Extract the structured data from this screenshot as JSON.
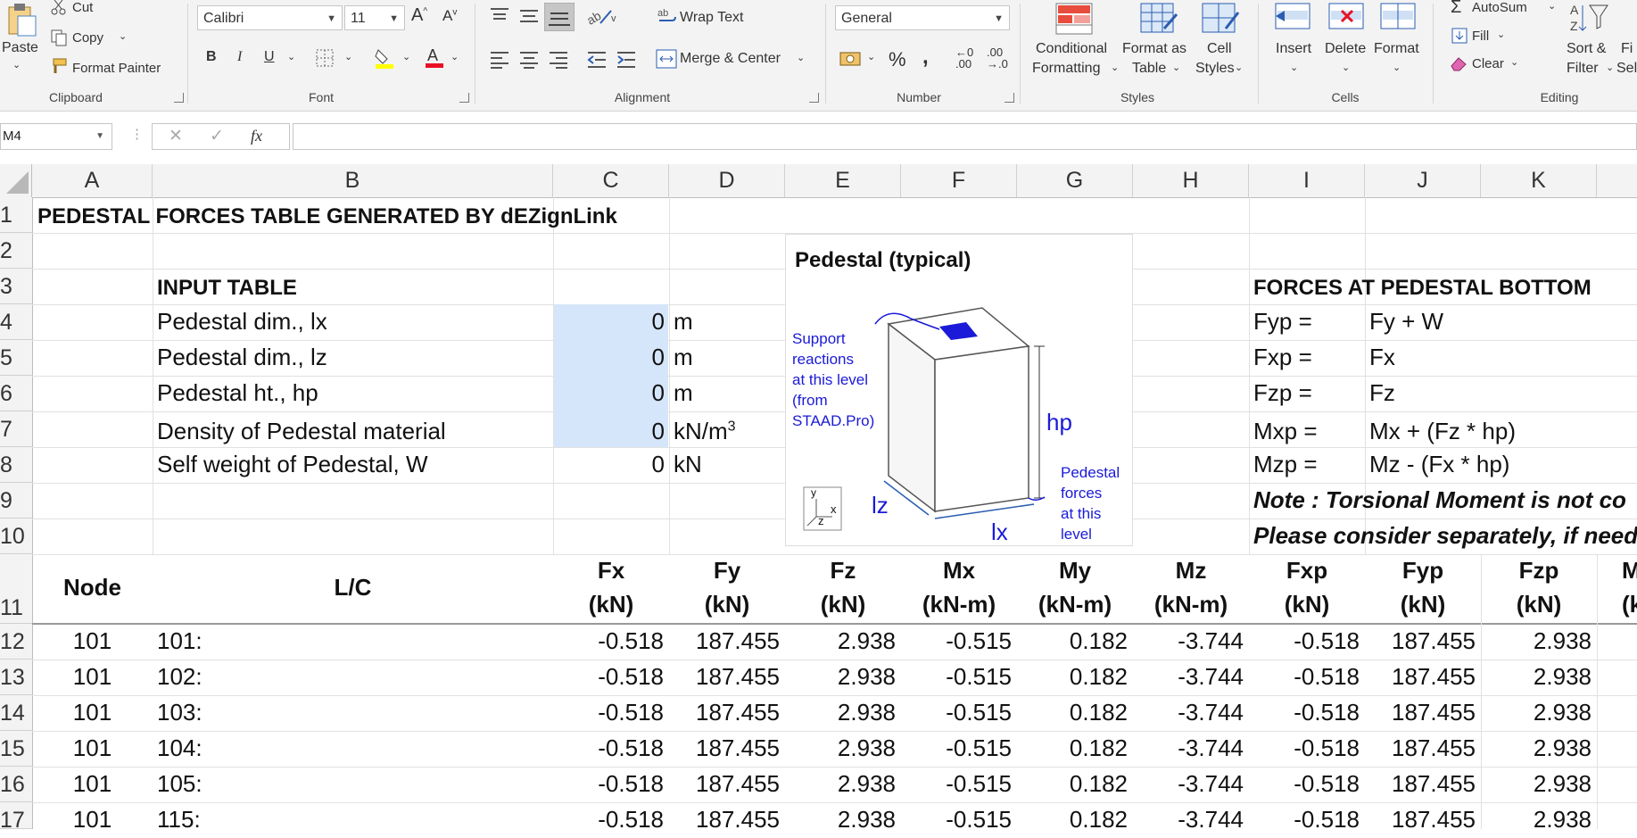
{
  "ribbon": {
    "clipboard": {
      "paste": "Paste",
      "cut": "Cut",
      "copy": "Copy",
      "format_painter": "Format Painter",
      "label": "Clipboard"
    },
    "font": {
      "name": "Calibri",
      "size": "11",
      "bold": "B",
      "italic": "I",
      "underline": "U",
      "label": "Font"
    },
    "alignment": {
      "wrap_text": "Wrap Text",
      "merge_center": "Merge & Center",
      "label": "Alignment"
    },
    "number": {
      "format": "General",
      "label": "Number"
    },
    "styles": {
      "conditional": "Conditional",
      "conditional2": "Formatting",
      "format_as": "Format as",
      "format_as2": "Table",
      "cell_styles": "Cell",
      "cell_styles2": "Styles",
      "label": "Styles"
    },
    "cells": {
      "insert": "Insert",
      "delete": "Delete",
      "format": "Format",
      "label": "Cells"
    },
    "editing": {
      "autosum": "AutoSum",
      "fill": "Fill",
      "clear": "Clear",
      "sort": "Sort &",
      "sort2": "Filter",
      "find": "Fi",
      "find2": "Sel",
      "label": "Editing"
    },
    "colors": {
      "highlight": "#ffff00",
      "fontcolor": "#e81123"
    }
  },
  "formula_bar": {
    "name_box": "M4",
    "fx": "fx",
    "value": ""
  },
  "columns": [
    "A",
    "B",
    "C",
    "D",
    "E",
    "F",
    "G",
    "H",
    "I",
    "J",
    "K"
  ],
  "rows": [
    "1",
    "2",
    "3",
    "4",
    "5",
    "6",
    "7",
    "8",
    "9",
    "10",
    "11",
    "12",
    "13",
    "14",
    "15",
    "16",
    "17"
  ],
  "sheet": {
    "title": "PEDESTAL FORCES TABLE GENERATED BY dEZignLink",
    "input_table": "INPUT TABLE",
    "inputs": [
      {
        "label": "Pedestal dim., lx",
        "value": "0",
        "unit": "m"
      },
      {
        "label": "Pedestal dim., lz",
        "value": "0",
        "unit": "m"
      },
      {
        "label": "Pedestal ht., hp",
        "value": "0",
        "unit": "m"
      },
      {
        "label": "Density of Pedestal material",
        "value": "0",
        "unit": "kN/m",
        "unit_sup": "3"
      },
      {
        "label": "Self weight of Pedestal, W",
        "value": "0",
        "unit": "kN"
      }
    ],
    "forces_title": "FORCES AT PEDESTAL BOTTOM",
    "forces": [
      {
        "lhs": "Fyp =",
        "rhs": "Fy + W"
      },
      {
        "lhs": "Fxp =",
        "rhs": "Fx"
      },
      {
        "lhs": "Fzp =",
        "rhs": "Fz"
      },
      {
        "lhs": "Mxp =",
        "rhs": "Mx + (Fz * hp)"
      },
      {
        "lhs": "Mzp =",
        "rhs": "Mz - (Fx * hp)"
      }
    ],
    "note1": "Note : Torsional Moment is not co",
    "note2": "Please consider separately, if need",
    "diagram": {
      "title": "Pedestal (typical)",
      "support": [
        "Support",
        "reactions",
        "at this level",
        "(from",
        "STAAD.Pro)"
      ],
      "hp": "hp",
      "lz": "lz",
      "lx": "lx",
      "forces": [
        "Pedestal",
        "forces",
        "at this",
        "level"
      ],
      "axis_x": "x",
      "axis_y": "y",
      "axis_z": "z"
    },
    "header": {
      "node": "Node",
      "lc": "L/C",
      "cols": [
        {
          "top": "Fx",
          "bottom": "(kN)"
        },
        {
          "top": "Fy",
          "bottom": "(kN)"
        },
        {
          "top": "Fz",
          "bottom": "(kN)"
        },
        {
          "top": "Mx",
          "bottom": "(kN-m)"
        },
        {
          "top": "My",
          "bottom": "(kN-m)"
        },
        {
          "top": "Mz",
          "bottom": "(kN-m)"
        },
        {
          "top": "Fxp",
          "bottom": "(kN)"
        },
        {
          "top": "Fyp",
          "bottom": "(kN)"
        },
        {
          "top": "Fzp",
          "bottom": "(kN)"
        },
        {
          "top": "M",
          "bottom": "(k"
        }
      ]
    },
    "data": [
      {
        "node": "101",
        "lc": "101:",
        "v": [
          "-0.518",
          "187.455",
          "2.938",
          "-0.515",
          "0.182",
          "-3.744",
          "-0.518",
          "187.455",
          "2.938"
        ]
      },
      {
        "node": "101",
        "lc": "102:",
        "v": [
          "-0.518",
          "187.455",
          "2.938",
          "-0.515",
          "0.182",
          "-3.744",
          "-0.518",
          "187.455",
          "2.938"
        ]
      },
      {
        "node": "101",
        "lc": "103:",
        "v": [
          "-0.518",
          "187.455",
          "2.938",
          "-0.515",
          "0.182",
          "-3.744",
          "-0.518",
          "187.455",
          "2.938"
        ]
      },
      {
        "node": "101",
        "lc": "104:",
        "v": [
          "-0.518",
          "187.455",
          "2.938",
          "-0.515",
          "0.182",
          "-3.744",
          "-0.518",
          "187.455",
          "2.938"
        ]
      },
      {
        "node": "101",
        "lc": "105:",
        "v": [
          "-0.518",
          "187.455",
          "2.938",
          "-0.515",
          "0.182",
          "-3.744",
          "-0.518",
          "187.455",
          "2.938"
        ]
      },
      {
        "node": "101",
        "lc": "115:",
        "v": [
          "-0.518",
          "187.455",
          "2.938",
          "-0.515",
          "0.182",
          "-3.744",
          "-0.518",
          "187.455",
          "2.938"
        ]
      }
    ]
  }
}
